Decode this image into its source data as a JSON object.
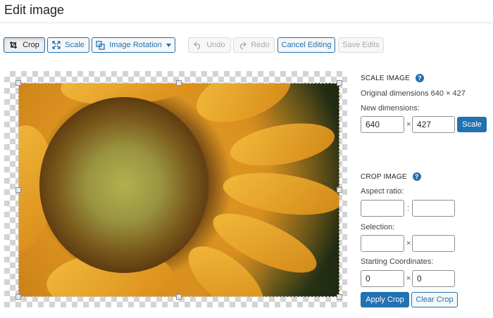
{
  "page": {
    "title": "Edit image"
  },
  "toolbar": {
    "crop_label": "Crop",
    "scale_label": "Scale",
    "rotation_label": "Image Rotation",
    "undo_label": "Undo",
    "redo_label": "Redo",
    "cancel_label": "Cancel Editing",
    "save_label": "Save Edits"
  },
  "scale": {
    "title": "SCALE IMAGE",
    "help": "?",
    "original": "Original dimensions 640 × 427",
    "new_label": "New dimensions:",
    "width": "640",
    "height": "427",
    "separator": "×",
    "button": "Scale"
  },
  "crop": {
    "title": "CROP IMAGE",
    "help": "?",
    "aspect_label": "Aspect ratio:",
    "aspect_sep": ":",
    "aspect_w": "",
    "aspect_h": "",
    "selection_label": "Selection:",
    "selection_sep": "×",
    "selection_w": "",
    "selection_h": "",
    "start_label": "Starting Coordinates:",
    "start_sep": "×",
    "start_x": "0",
    "start_y": "0",
    "apply_button": "Apply Crop",
    "clear_button": "Clear Crop"
  },
  "icons": {
    "crop": "crop-icon",
    "scale": "scale-icon",
    "rotation": "rotation-icon",
    "dropdown": "chevron-down-icon",
    "undo": "undo-icon",
    "redo": "redo-icon",
    "help": "help-icon"
  },
  "colors": {
    "accent": "#2271b1",
    "disabled": "#a7aaad"
  }
}
